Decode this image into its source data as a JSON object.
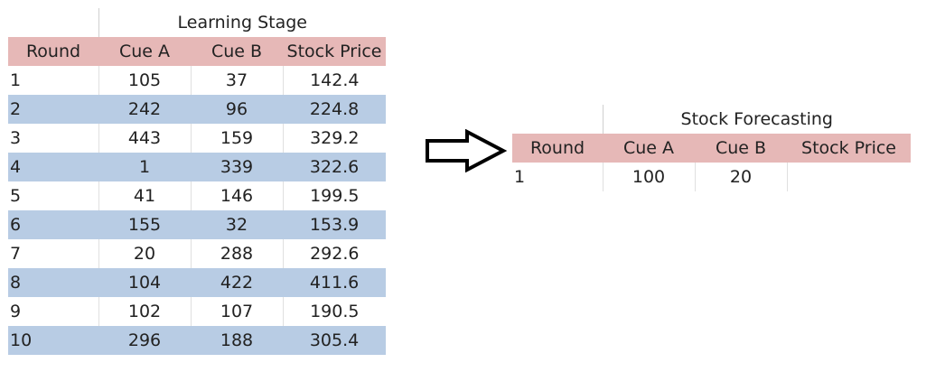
{
  "learning": {
    "title": "Learning Stage",
    "headers": [
      "Round",
      "Cue A",
      "Cue B",
      "Stock Price"
    ],
    "rows": [
      [
        "1",
        "105",
        "37",
        "142.4"
      ],
      [
        "2",
        "242",
        "96",
        "224.8"
      ],
      [
        "3",
        "443",
        "159",
        "329.2"
      ],
      [
        "4",
        "1",
        "339",
        "322.6"
      ],
      [
        "5",
        "41",
        "146",
        "199.5"
      ],
      [
        "6",
        "155",
        "32",
        "153.9"
      ],
      [
        "7",
        "20",
        "288",
        "292.6"
      ],
      [
        "8",
        "104",
        "422",
        "411.6"
      ],
      [
        "9",
        "102",
        "107",
        "190.5"
      ],
      [
        "10",
        "296",
        "188",
        "305.4"
      ]
    ]
  },
  "forecast": {
    "title": "Stock Forecasting",
    "headers": [
      "Round",
      "Cue A",
      "Cue B",
      "Stock Price"
    ],
    "rows": [
      [
        "1",
        "100",
        "20",
        ""
      ]
    ]
  },
  "colors": {
    "header_bg": "#e6b8b7",
    "alt_row_bg": "#b8cce4"
  },
  "icons": {
    "arrow": "right-arrow-icon"
  }
}
